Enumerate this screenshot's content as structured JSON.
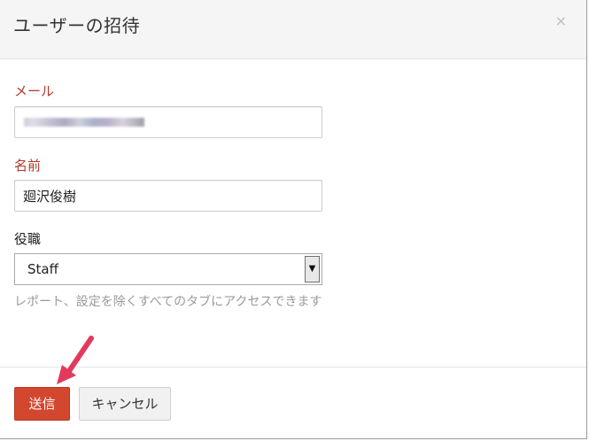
{
  "dialog": {
    "title": "ユーザーの招待",
    "close_icon": "×"
  },
  "form": {
    "email": {
      "label": "メール",
      "value": ""
    },
    "name": {
      "label": "名前",
      "value": "廻沢俊樹"
    },
    "role": {
      "label": "役職",
      "selected": "Staff",
      "help": "レポート、設定を除くすべてのタブにアクセスできます"
    }
  },
  "footer": {
    "submit_label": "送信",
    "cancel_label": "キャンセル"
  },
  "colors": {
    "required_label": "#b0392b",
    "primary_button": "#d4472f",
    "annotation_arrow": "#e23a5d"
  }
}
